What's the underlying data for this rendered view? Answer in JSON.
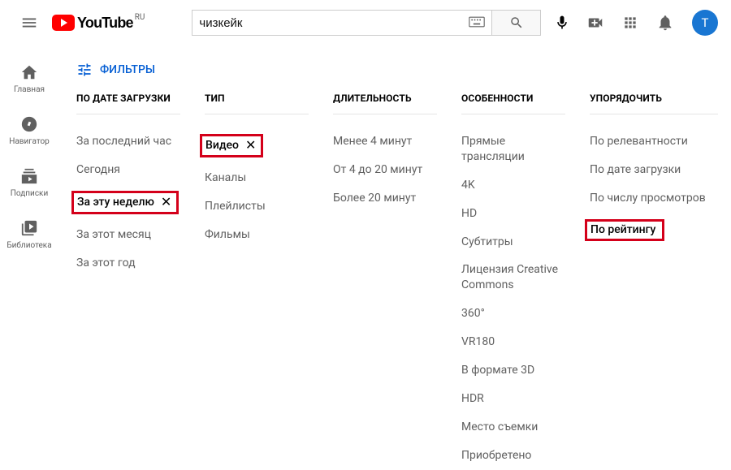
{
  "header": {
    "logo_text": "YouTube",
    "logo_region": "RU",
    "search_value": "чизкейк",
    "avatar_initial": "T"
  },
  "sidebar": {
    "items": [
      {
        "label": "Главная"
      },
      {
        "label": "Навигатор"
      },
      {
        "label": "Подписки"
      },
      {
        "label": "Библиотека"
      }
    ]
  },
  "filters_button": "ФИЛЬТРЫ",
  "filter_columns": [
    {
      "header": "ПО ДАТЕ ЗАГРУЗКИ",
      "options": [
        {
          "label": "За последний час"
        },
        {
          "label": "Сегодня"
        },
        {
          "label": "За эту неделю",
          "selected": true,
          "highlighted": true
        },
        {
          "label": "За этот месяц"
        },
        {
          "label": "За этот год"
        }
      ]
    },
    {
      "header": "ТИП",
      "options": [
        {
          "label": "Видео",
          "selected": true,
          "highlighted": true
        },
        {
          "label": "Каналы"
        },
        {
          "label": "Плейлисты"
        },
        {
          "label": "Фильмы"
        }
      ]
    },
    {
      "header": "ДЛИТЕЛЬНОСТЬ",
      "options": [
        {
          "label": "Менее 4 минут"
        },
        {
          "label": "От 4 до 20 минут"
        },
        {
          "label": "Более 20 минут"
        }
      ]
    },
    {
      "header": "ОСОБЕННОСТИ",
      "options": [
        {
          "label": "Прямые трансляции"
        },
        {
          "label": "4K"
        },
        {
          "label": "HD"
        },
        {
          "label": "Субтитры"
        },
        {
          "label": "Лицензия Creative Commons"
        },
        {
          "label": "360°"
        },
        {
          "label": "VR180"
        },
        {
          "label": "В формате 3D"
        },
        {
          "label": "HDR"
        },
        {
          "label": "Место съемки"
        },
        {
          "label": "Приобретено"
        }
      ]
    },
    {
      "header": "УПОРЯДОЧИТЬ",
      "options": [
        {
          "label": "По релевантности"
        },
        {
          "label": "По дате загрузки"
        },
        {
          "label": "По числу просмотров"
        },
        {
          "label": "По рейтингу",
          "highlighted": true
        }
      ]
    }
  ]
}
